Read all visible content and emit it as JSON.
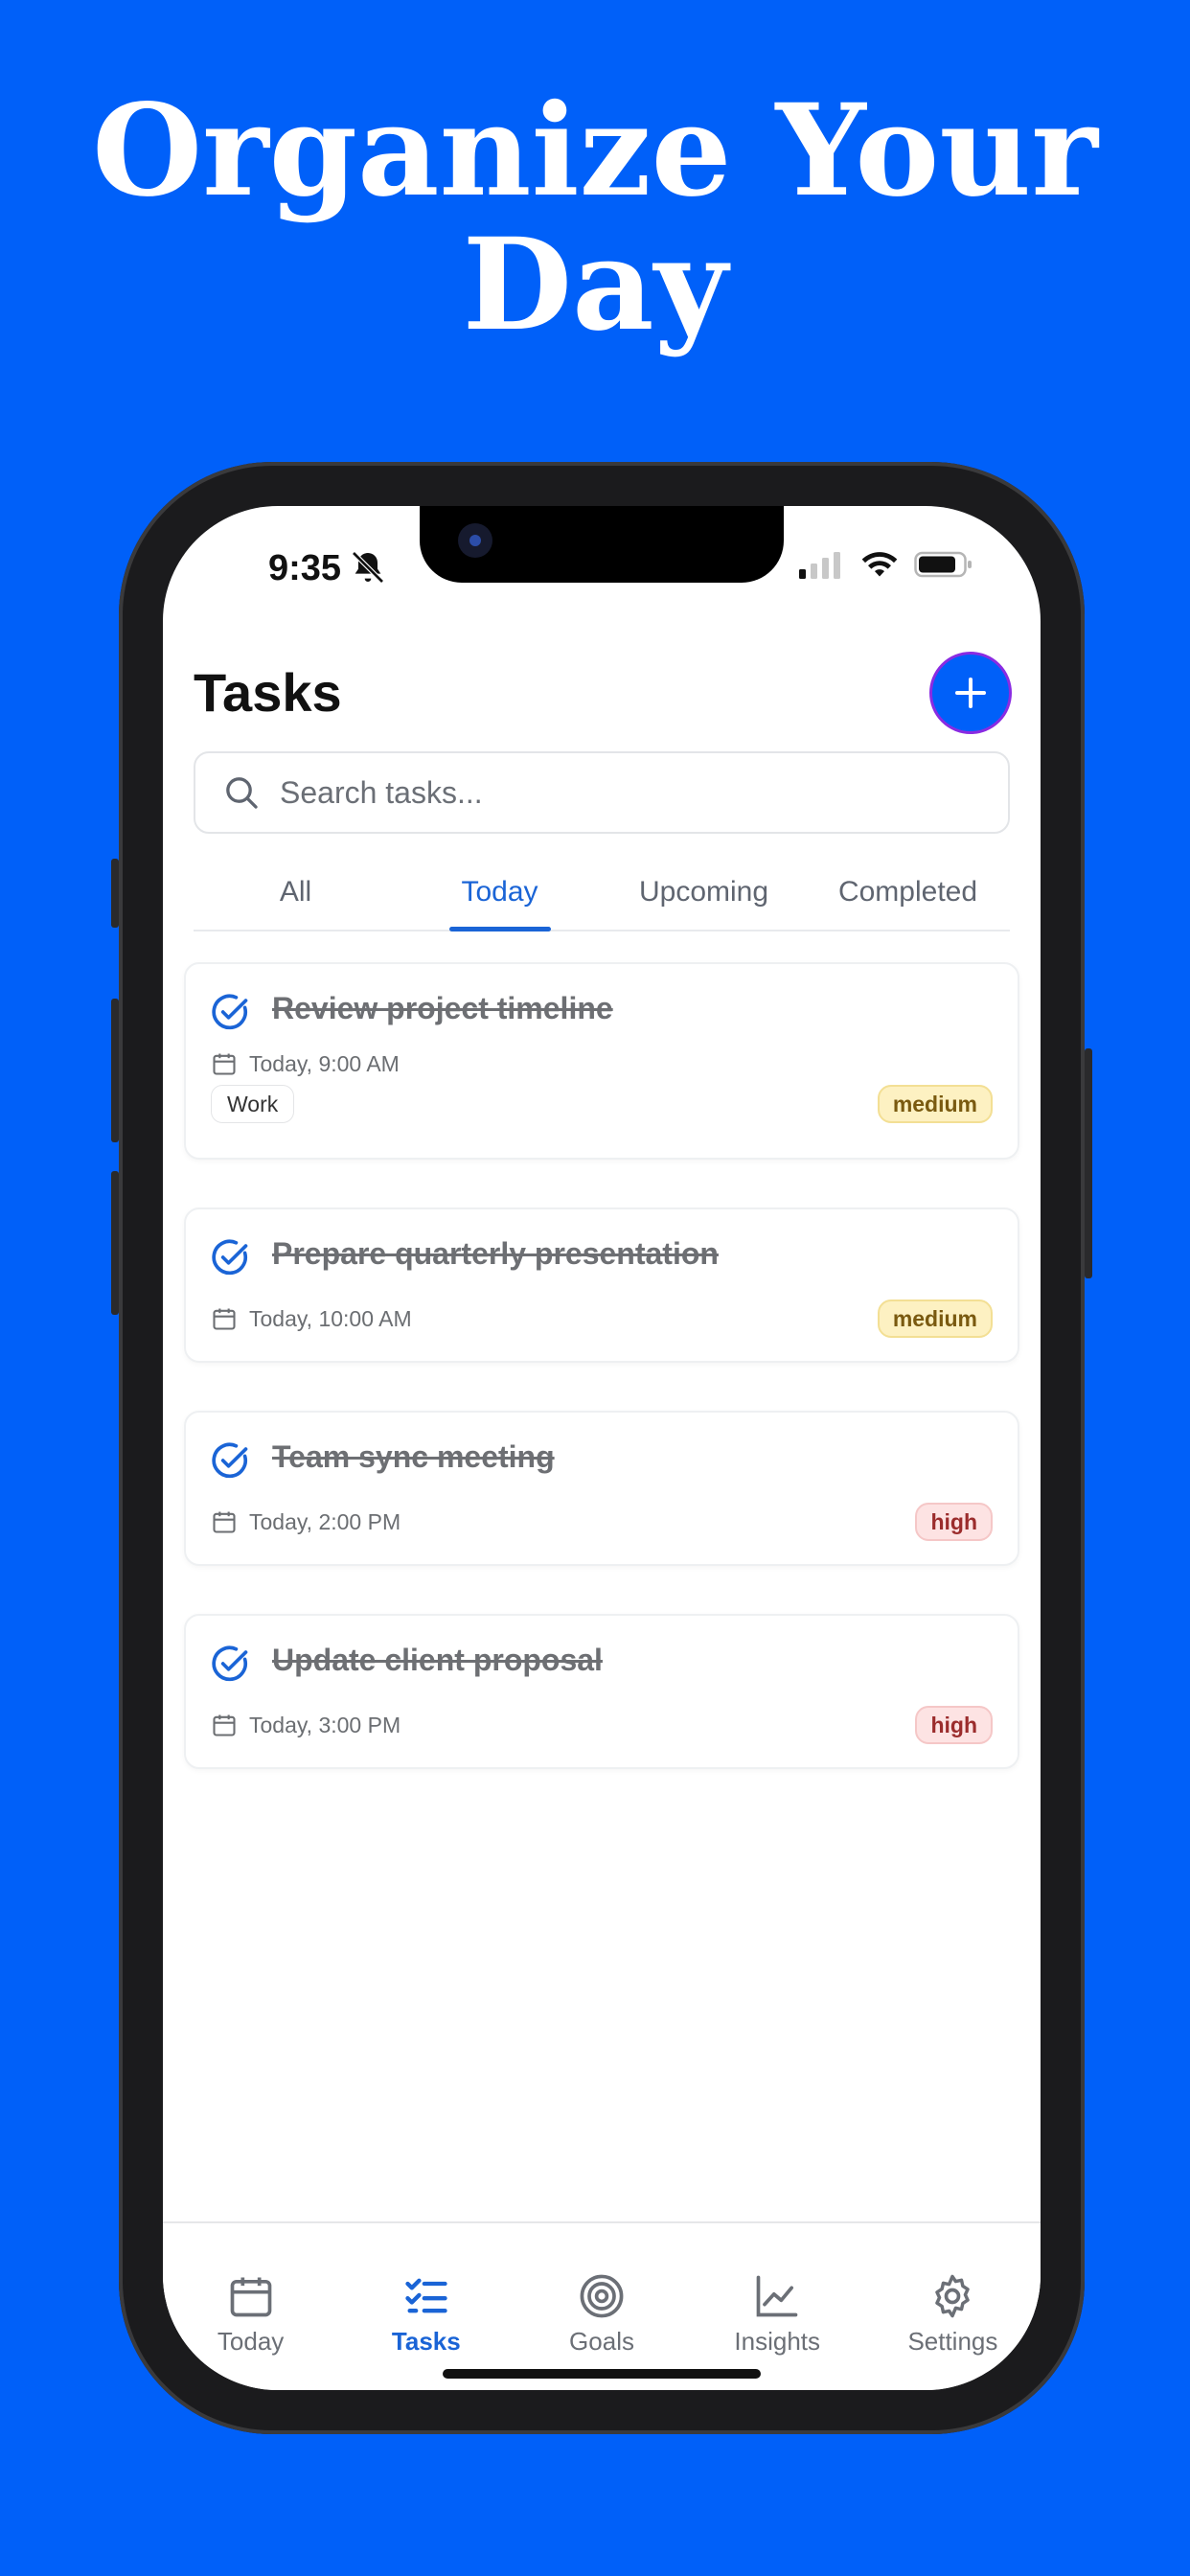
{
  "promo": {
    "headline_line1": "Organize Your",
    "headline_line2": "Day"
  },
  "status_bar": {
    "time": "9:35"
  },
  "header": {
    "title": "Tasks",
    "add_icon": "plus-icon"
  },
  "search": {
    "placeholder": "Search tasks...",
    "value": ""
  },
  "tabs": [
    {
      "label": "All",
      "active": false
    },
    {
      "label": "Today",
      "active": true
    },
    {
      "label": "Upcoming",
      "active": false
    },
    {
      "label": "Completed",
      "active": false
    }
  ],
  "tasks": [
    {
      "title": "Review project timeline",
      "time": "Today, 9:00 AM",
      "tag": "Work",
      "priority": "medium",
      "completed": true
    },
    {
      "title": "Prepare quarterly presentation",
      "time": "Today, 10:00 AM",
      "priority": "medium",
      "completed": true
    },
    {
      "title": "Team sync meeting",
      "time": "Today, 2:00 PM",
      "priority": "high",
      "completed": true
    },
    {
      "title": "Update client proposal",
      "time": "Today, 3:00 PM",
      "priority": "high",
      "completed": true
    }
  ],
  "bottom_nav": [
    {
      "label": "Today",
      "icon": "calendar-icon",
      "active": false
    },
    {
      "label": "Tasks",
      "icon": "checklist-icon",
      "active": true
    },
    {
      "label": "Goals",
      "icon": "target-icon",
      "active": false
    },
    {
      "label": "Insights",
      "icon": "chart-icon",
      "active": false
    },
    {
      "label": "Settings",
      "icon": "gear-icon",
      "active": false
    }
  ],
  "colors": {
    "background": "#0060F9",
    "accent": "#1a64d6",
    "medium": "#fdf1c2",
    "high": "#fde3e3"
  }
}
